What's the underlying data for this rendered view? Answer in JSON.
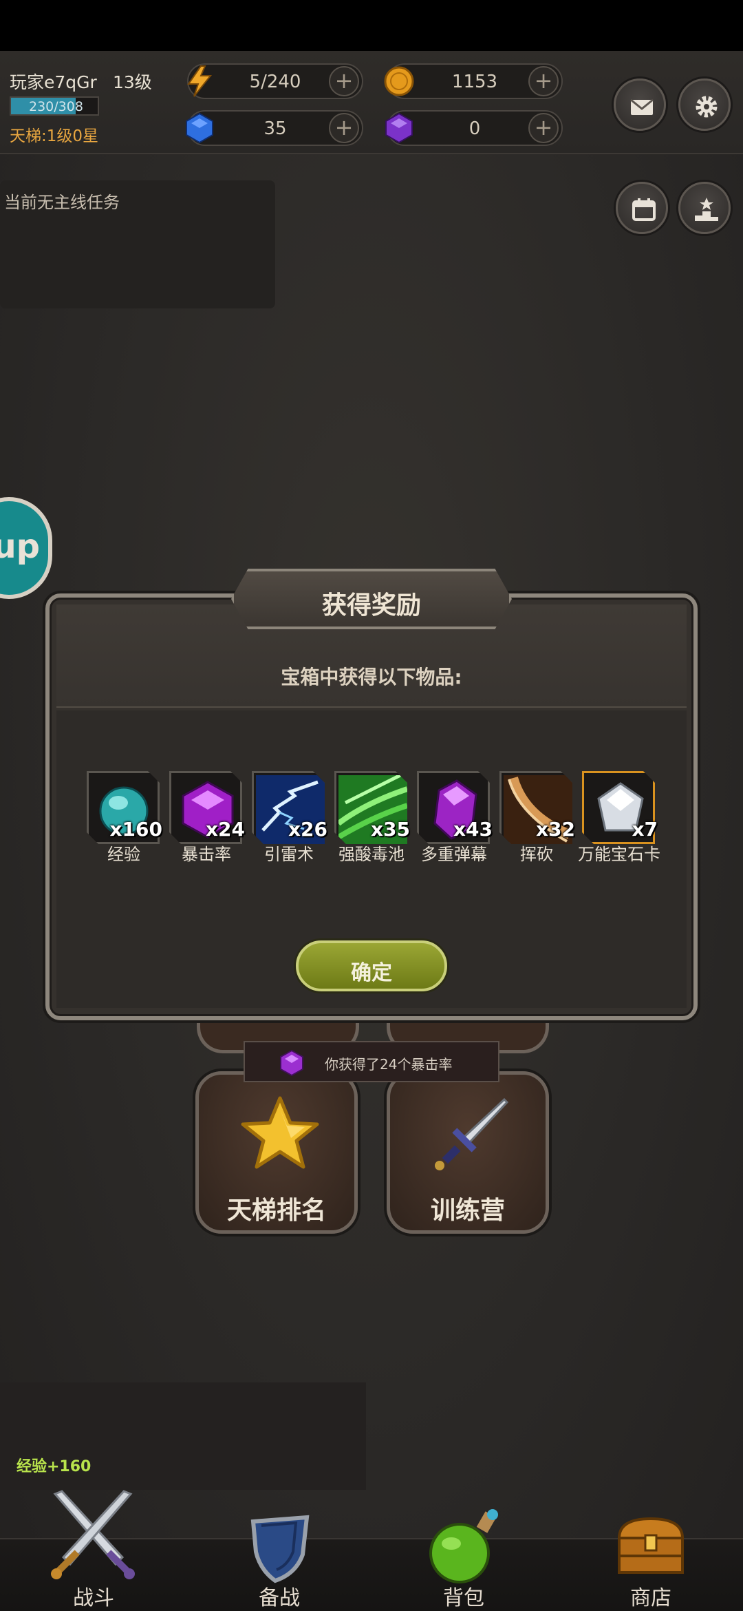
{
  "player": {
    "name": "玩家e7qGr",
    "level": "13级",
    "xp": "230/308",
    "xp_progress": 0.747,
    "ladder": "天梯:1级0星"
  },
  "resources": {
    "energy": "5/240",
    "gold": "1153",
    "gems": "35",
    "purple": "0",
    "plus": "+"
  },
  "quest": {
    "text": "当前无主线任务"
  },
  "side_button": {
    "label": "up"
  },
  "menu": {
    "ladder_rank": "天梯排名",
    "training_camp": "训练营"
  },
  "toast": {
    "text": "你获得了24个暴击率"
  },
  "exp_gain": "经验+160",
  "nav": {
    "battle": "战斗",
    "prepare": "备战",
    "bag": "背包",
    "shop": "商店"
  },
  "modal": {
    "title": "获得奖励",
    "subtitle": "宝箱中获得以下物品:",
    "confirm": "确定",
    "items": [
      {
        "name": "经验",
        "count": "x160"
      },
      {
        "name": "暴击率",
        "count": "x24"
      },
      {
        "name": "引雷术",
        "count": "x26"
      },
      {
        "name": "强酸毒池",
        "count": "x35"
      },
      {
        "name": "多重弹幕",
        "count": "x43"
      },
      {
        "name": "挥砍",
        "count": "x32"
      },
      {
        "name": "万能宝石卡",
        "count": "x7"
      }
    ]
  },
  "colors": {
    "accent_gold": "#d9921f",
    "confirm_green": "#8a9628",
    "xp_teal": "#2f8fa8",
    "exp_text": "#b9e44c"
  }
}
